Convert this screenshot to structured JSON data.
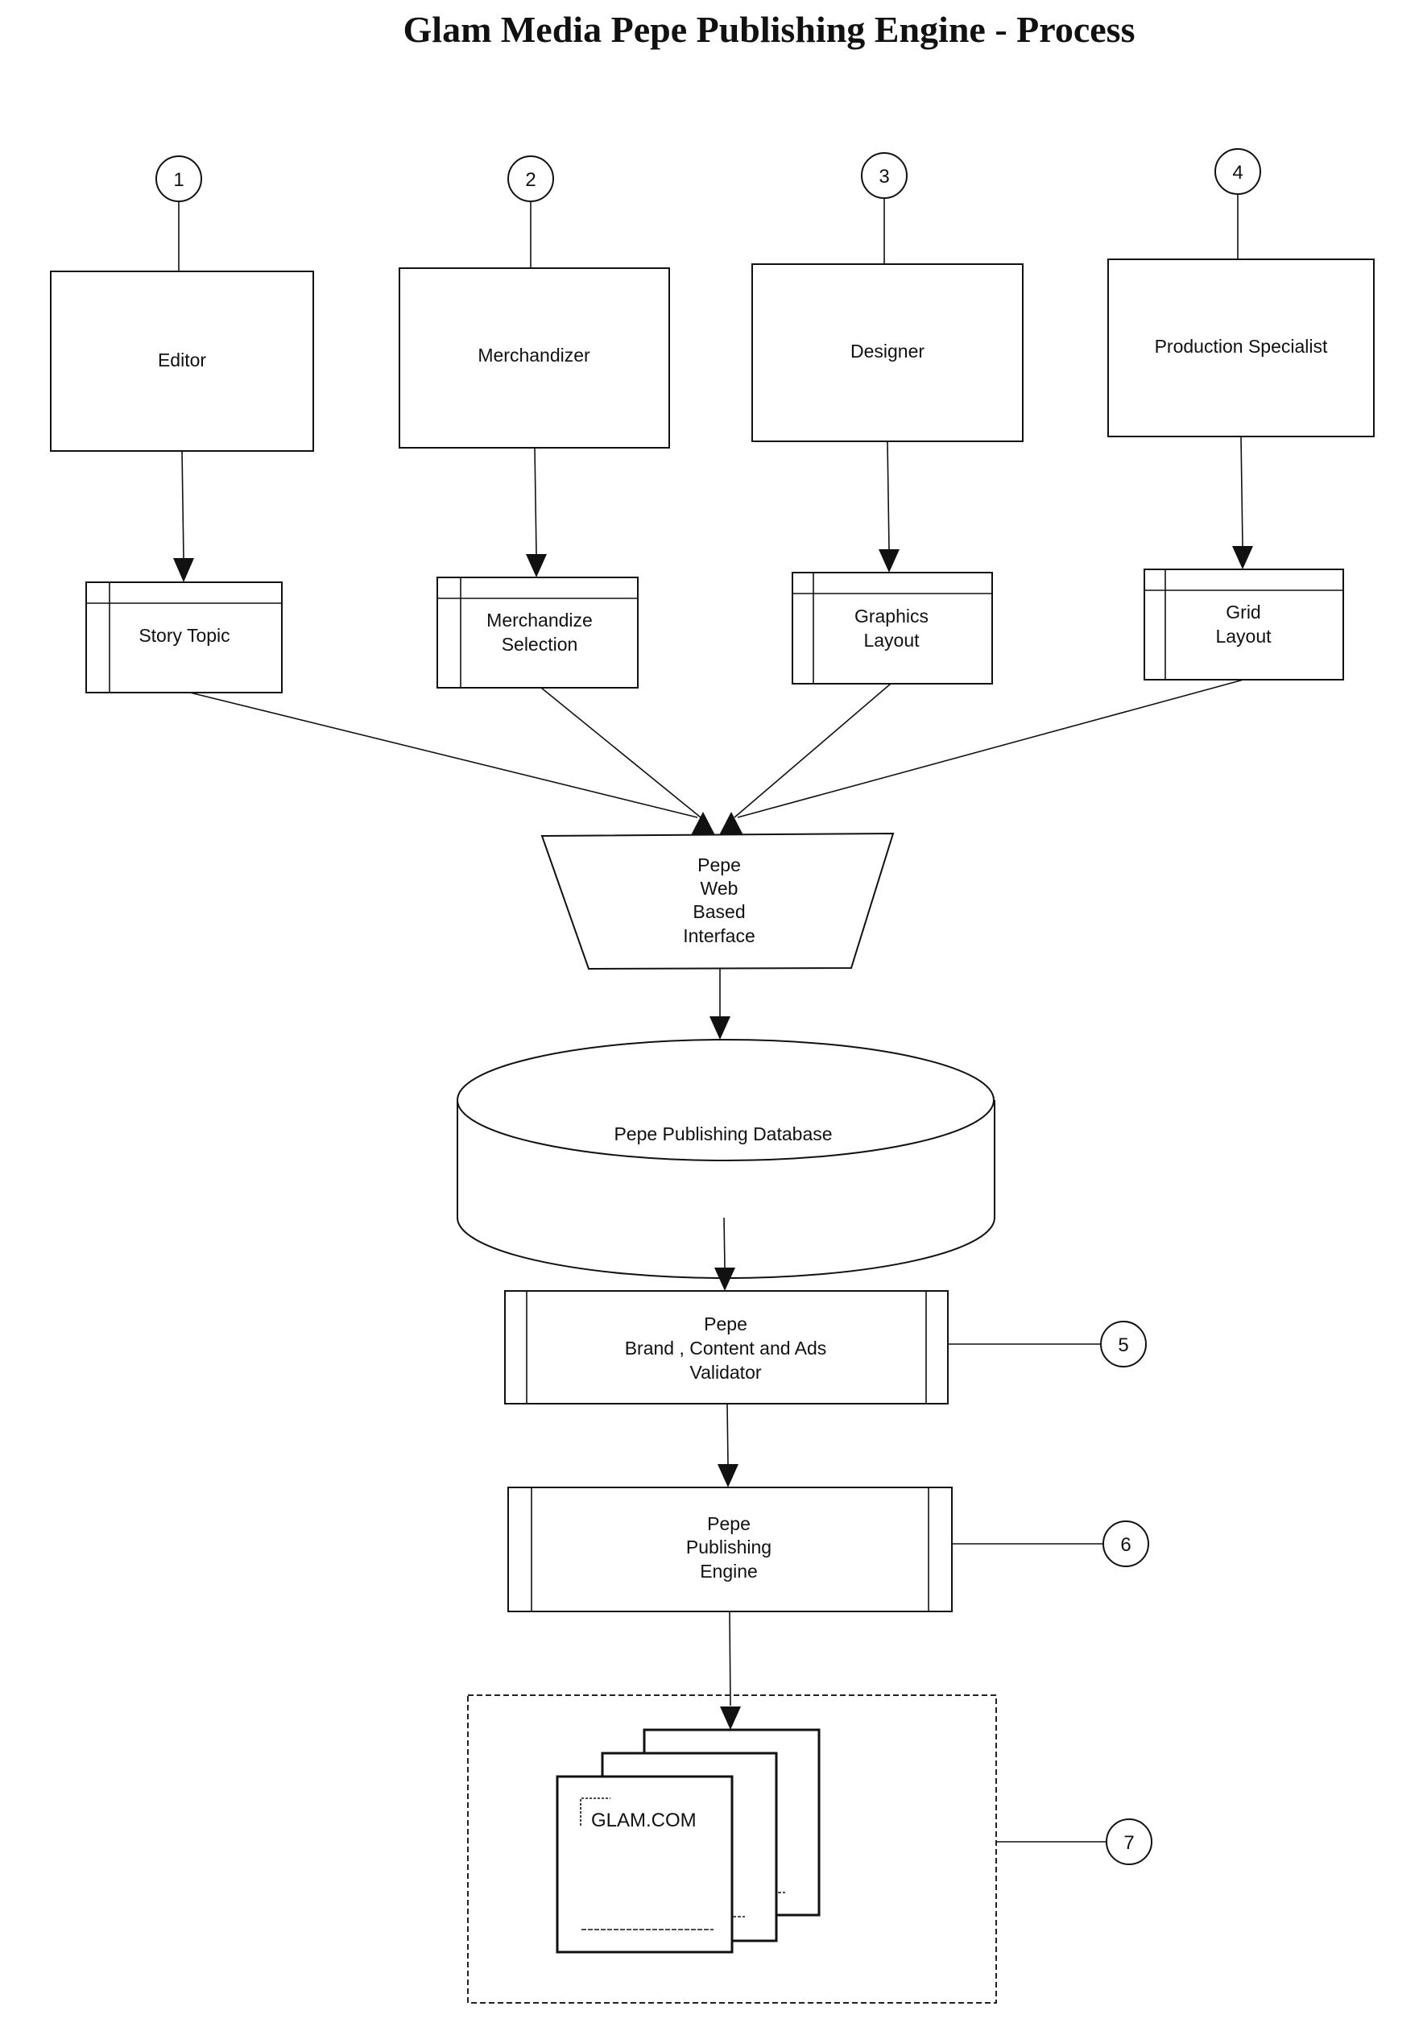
{
  "title": "Glam Media Pepe Publishing Engine - Process",
  "roles": [
    {
      "step": "1",
      "label": "Editor",
      "output": [
        "Story Topic"
      ]
    },
    {
      "step": "2",
      "label": "Merchandizer",
      "output": [
        "Merchandize",
        "Selection"
      ]
    },
    {
      "step": "3",
      "label": "Designer",
      "output": [
        "Graphics",
        "Layout"
      ]
    },
    {
      "step": "4",
      "label": "Production Specialist",
      "output": [
        "Grid",
        "Layout"
      ]
    }
  ],
  "interface": {
    "lines": [
      "Pepe",
      "Web",
      "Based",
      "Interface"
    ]
  },
  "database": {
    "label": "Pepe Publishing Database"
  },
  "validator": {
    "step": "5",
    "lines": [
      "Pepe",
      "Brand , Content and Ads",
      "Validator"
    ]
  },
  "engine": {
    "step": "6",
    "lines": [
      "Pepe",
      "Publishing",
      "Engine"
    ]
  },
  "output": {
    "step": "7",
    "page_label": "GLAM.COM"
  }
}
